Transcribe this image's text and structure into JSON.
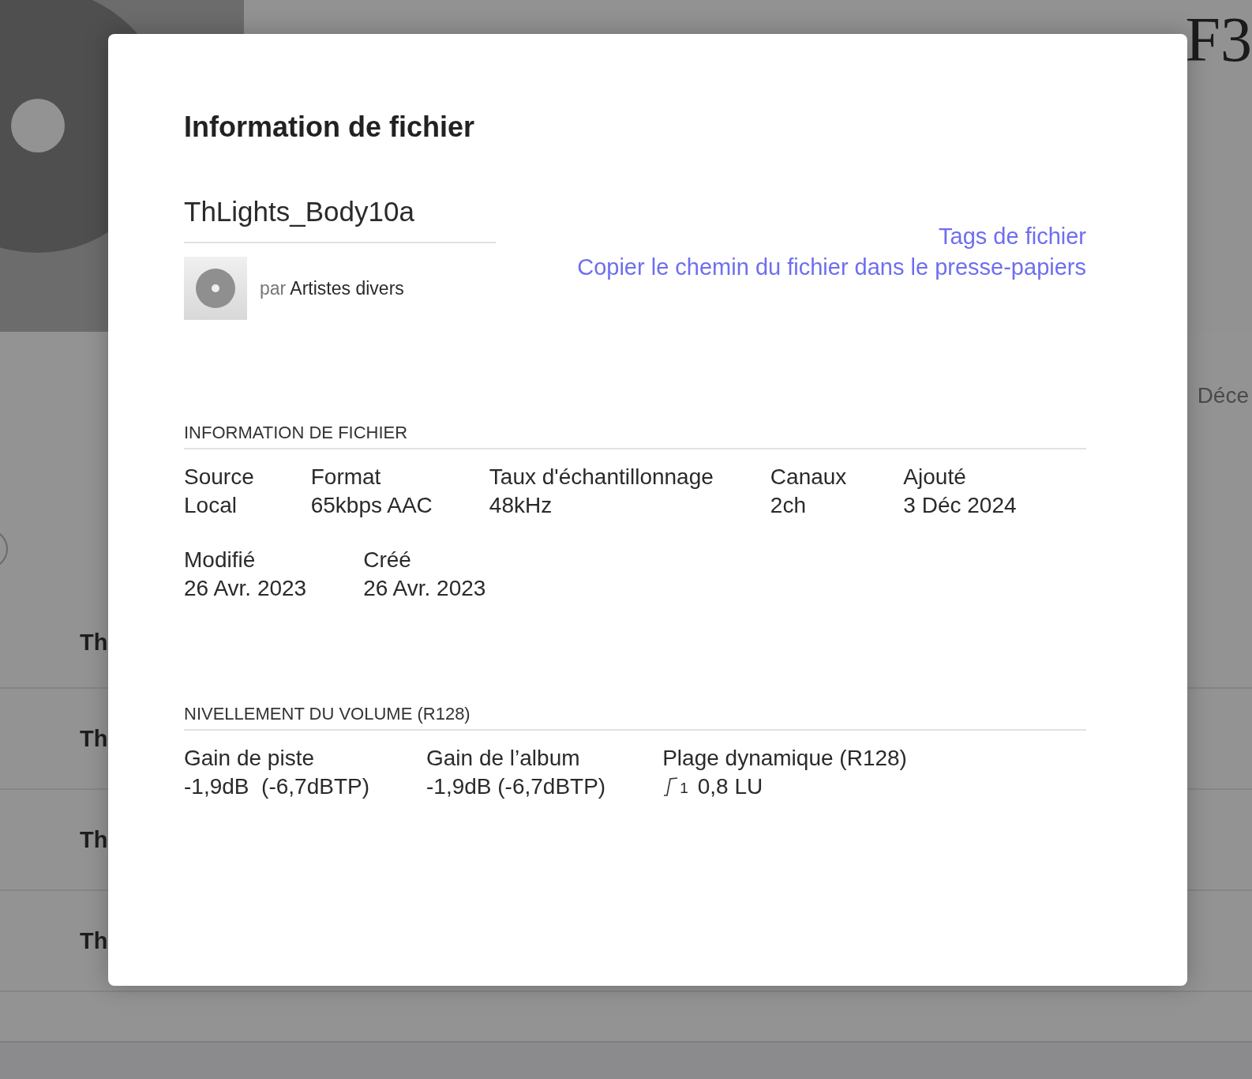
{
  "background": {
    "title_fragment": "F3",
    "date_fragment": "Déce",
    "rows": [
      {
        "title_fragment": "Th"
      },
      {
        "title_fragment": "Th"
      },
      {
        "title_fragment": "Th"
      },
      {
        "title_fragment": "Th"
      }
    ]
  },
  "dialog": {
    "title": "Information de fichier",
    "track_name": "ThLights_Body10a",
    "by_label": "par",
    "artist": "Artistes divers",
    "links": [
      "Tags de fichier",
      "Copier le chemin du fichier dans le presse-papiers"
    ],
    "sections": [
      {
        "heading": "INFORMATION DE FICHIER",
        "rows": [
          [
            {
              "label": "Source",
              "value": "Local"
            },
            {
              "label": "Format",
              "value": "65kbps AAC"
            },
            {
              "label": "Taux d'échantillonnage",
              "value": "48kHz"
            },
            {
              "label": "Canaux",
              "value": "2ch"
            },
            {
              "label": "Ajouté",
              "value": "3 Déc 2024"
            }
          ],
          [
            {
              "label": "Modifié",
              "value": "26 Avr. 2023"
            },
            {
              "label": "Créé",
              "value": "26 Avr. 2023"
            }
          ]
        ]
      },
      {
        "heading": "NIVELLEMENT DU VOLUME (R128)",
        "rows": [
          [
            {
              "label": "Gain de piste",
              "value": "-1,9dB  (-6,7dBTP)"
            },
            {
              "label": "Gain de l’album",
              "value": "-1,9dB (-6,7dBTP)"
            },
            {
              "label": "Plage dynamique (R128)",
              "value": "0,8 LU",
              "kind": "range",
              "icon_text": "1"
            }
          ]
        ]
      }
    ]
  }
}
